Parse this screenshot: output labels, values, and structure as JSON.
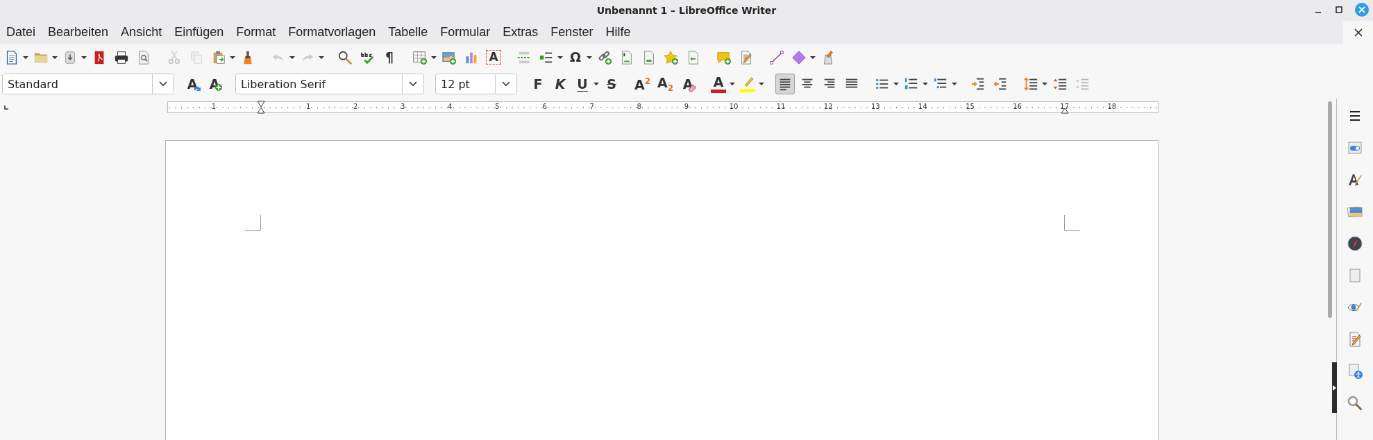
{
  "window": {
    "title": "Unbenannt 1 – LibreOffice Writer"
  },
  "menu": [
    "Datei",
    "Bearbeiten",
    "Ansicht",
    "Einfügen",
    "Format",
    "Formatvorlagen",
    "Tabelle",
    "Formular",
    "Extras",
    "Fenster",
    "Hilfe"
  ],
  "toolbar_standard": [
    [
      {
        "kind": "new-document",
        "dropdown": true
      },
      {
        "kind": "open",
        "dropdown": true
      },
      {
        "kind": "save",
        "dropdown": true
      },
      {
        "kind": "pdf"
      },
      {
        "kind": "print"
      },
      {
        "kind": "preview"
      }
    ],
    [
      {
        "kind": "cut",
        "disabled": true
      },
      {
        "kind": "copy",
        "disabled": true
      },
      {
        "kind": "paste",
        "dropdown": true
      },
      {
        "kind": "clone"
      }
    ],
    [
      {
        "kind": "undo",
        "dropdown": true,
        "disabled": true
      },
      {
        "kind": "redo",
        "dropdown": true,
        "disabled": true
      }
    ],
    [
      {
        "kind": "find-replace"
      },
      {
        "kind": "spellcheck"
      },
      {
        "kind": "pilcrow",
        "glyph": "¶"
      }
    ],
    [
      {
        "kind": "table",
        "dropdown": true
      },
      {
        "kind": "image"
      },
      {
        "kind": "chart"
      },
      {
        "kind": "textbox",
        "glyph": "A"
      }
    ],
    [
      {
        "kind": "page-break"
      },
      {
        "kind": "field",
        "dropdown": true
      },
      {
        "kind": "omega",
        "glyph": "Ω",
        "dropdown": true
      },
      {
        "kind": "hyperlink"
      },
      {
        "kind": "footnote"
      },
      {
        "kind": "endnote"
      },
      {
        "kind": "bookmark"
      },
      {
        "kind": "cross-reference"
      }
    ],
    [
      {
        "kind": "comment"
      },
      {
        "kind": "track-changes"
      }
    ],
    [
      {
        "kind": "line"
      },
      {
        "kind": "shapes",
        "dropdown": true
      },
      {
        "kind": "draw-functions"
      }
    ]
  ],
  "toolbar_formatting": [
    [
      {
        "kind": "style-combo",
        "value": "Standard"
      },
      {
        "kind": "update-style",
        "glyph": "A"
      },
      {
        "kind": "new-style",
        "glyph": "A"
      }
    ],
    [
      {
        "kind": "font-combo",
        "value": "Liberation Serif"
      }
    ],
    [
      {
        "kind": "size-combo",
        "value": "12 pt"
      }
    ],
    [
      {
        "kind": "bold",
        "glyph": "F"
      },
      {
        "kind": "italic",
        "glyph": "K"
      },
      {
        "kind": "underline",
        "glyph": "U",
        "dropdown": true
      },
      {
        "kind": "strike",
        "glyph": "S"
      }
    ],
    [
      {
        "kind": "superscript",
        "glyph": "A",
        "mark": "2"
      },
      {
        "kind": "subscript",
        "glyph": "A",
        "mark": "2"
      },
      {
        "kind": "clear-format",
        "glyph": "A"
      }
    ],
    [
      {
        "kind": "font-color",
        "glyph": "A",
        "color": "#c9211e",
        "dropdown": true
      },
      {
        "kind": "highlight",
        "color": "#ffff00",
        "dropdown": true
      }
    ],
    [
      {
        "kind": "align-left",
        "selected": true
      },
      {
        "kind": "align-center",
        "selected": false
      },
      {
        "kind": "align-right",
        "selected": false
      },
      {
        "kind": "justify",
        "selected": false
      }
    ],
    [
      {
        "kind": "bullets",
        "dropdown": true
      },
      {
        "kind": "numbering",
        "dropdown": true
      },
      {
        "kind": "outline",
        "dropdown": true
      }
    ],
    [
      {
        "kind": "indent-increase"
      },
      {
        "kind": "indent-decrease"
      }
    ],
    [
      {
        "kind": "line-spacing",
        "dropdown": true
      },
      {
        "kind": "para-spacing-increase"
      },
      {
        "kind": "para-spacing-decrease",
        "disabled": true
      }
    ]
  ],
  "ruler": {
    "labels": [
      "1",
      "1",
      "2",
      "3",
      "4",
      "5",
      "6",
      "7",
      "8",
      "9",
      "10",
      "11",
      "12",
      "13",
      "14",
      "15",
      "16",
      "17",
      "18"
    ]
  },
  "sidebar": [
    {
      "kind": "menu"
    },
    {
      "kind": "properties"
    },
    {
      "kind": "styles"
    },
    {
      "kind": "gallery"
    },
    {
      "kind": "navigator"
    },
    {
      "kind": "page"
    },
    {
      "kind": "style-inspector"
    },
    {
      "kind": "manage-changes"
    },
    {
      "kind": "accessibility"
    },
    {
      "kind": "find"
    }
  ]
}
